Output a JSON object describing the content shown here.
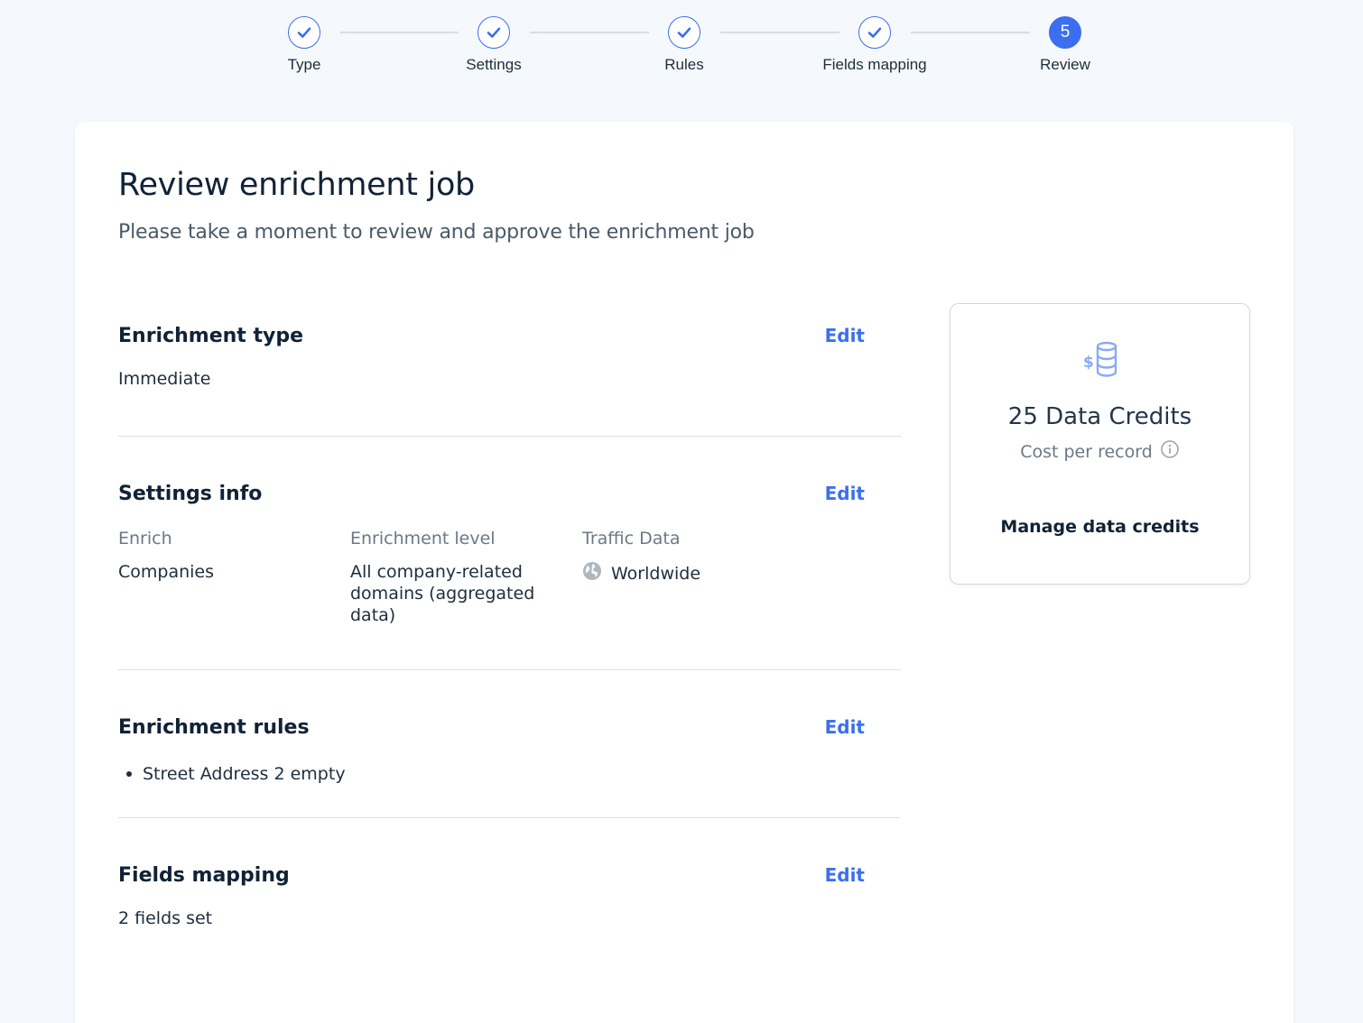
{
  "stepper": {
    "steps": [
      {
        "label": "Type",
        "state": "done"
      },
      {
        "label": "Settings",
        "state": "done"
      },
      {
        "label": "Rules",
        "state": "done"
      },
      {
        "label": "Fields mapping",
        "state": "done"
      },
      {
        "label": "Review",
        "state": "active",
        "number": "5"
      }
    ]
  },
  "page": {
    "title": "Review enrichment job",
    "subtitle": "Please take a moment to review and approve the enrichment job"
  },
  "sections": {
    "enrichment_type": {
      "title": "Enrichment type",
      "edit": "Edit",
      "value": "Immediate"
    },
    "settings_info": {
      "title": "Settings info",
      "edit": "Edit",
      "enrich_label": "Enrich",
      "enrich_value": "Companies",
      "level_label": "Enrichment level",
      "level_value": "All company-related domains (aggregated data)",
      "traffic_label": "Traffic Data",
      "traffic_value": "Worldwide"
    },
    "enrichment_rules": {
      "title": "Enrichment rules",
      "edit": "Edit",
      "rules": [
        "Street Address 2 empty"
      ]
    },
    "fields_mapping": {
      "title": "Fields mapping",
      "edit": "Edit",
      "value": "2 fields set"
    }
  },
  "credits": {
    "amount": "25 Data Credits",
    "cost_label": "Cost per record",
    "manage": "Manage data credits"
  },
  "colors": {
    "accent": "#3b6ff0",
    "text": "#102236",
    "muted": "#6c7886"
  }
}
